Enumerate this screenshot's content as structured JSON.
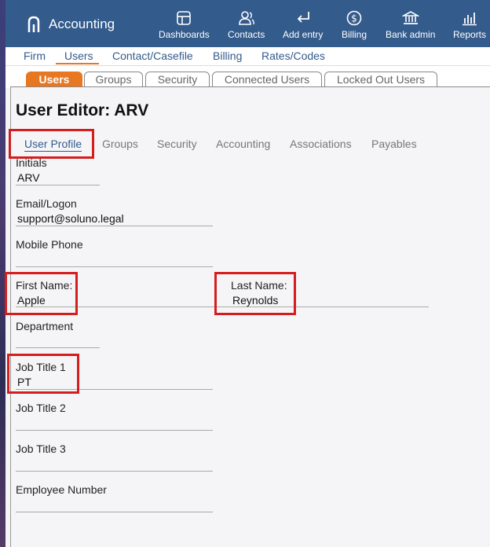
{
  "app": {
    "name": "Accounting"
  },
  "nav": [
    {
      "label": "Dashboards",
      "icon": "dashboard-icon"
    },
    {
      "label": "Contacts",
      "icon": "contacts-icon"
    },
    {
      "label": "Add entry",
      "icon": "add-entry-icon"
    },
    {
      "label": "Billing",
      "icon": "billing-icon"
    },
    {
      "label": "Bank admin",
      "icon": "bank-icon"
    },
    {
      "label": "Reports",
      "icon": "reports-icon"
    }
  ],
  "subnav": [
    "Firm",
    "Users",
    "Contact/Casefile",
    "Billing",
    "Rates/Codes"
  ],
  "tabs": [
    "Users",
    "Groups",
    "Security",
    "Connected Users",
    "Locked Out Users"
  ],
  "page_title": "User Editor: ARV",
  "profile_tabs": [
    "User Profile",
    "Groups",
    "Security",
    "Accounting",
    "Associations",
    "Payables"
  ],
  "form": {
    "initials": {
      "label": "Initials",
      "value": "ARV"
    },
    "email": {
      "label": "Email/Logon",
      "value": "support@soluno.legal"
    },
    "mobile": {
      "label": "Mobile Phone",
      "value": ""
    },
    "first_name": {
      "label": "First Name:",
      "value": "Apple"
    },
    "last_name": {
      "label": "Last Name:",
      "value": "Reynolds"
    },
    "department": {
      "label": "Department",
      "value": ""
    },
    "job_title_1": {
      "label": "Job Title 1",
      "value": "PT"
    },
    "job_title_2": {
      "label": "Job Title 2",
      "value": ""
    },
    "job_title_3": {
      "label": "Job Title 3",
      "value": ""
    },
    "employee_number": {
      "label": "Employee Number",
      "value": ""
    }
  },
  "colors": {
    "topbar": "#335b8c",
    "accent": "#e87722",
    "highlight": "#d41e1e"
  }
}
